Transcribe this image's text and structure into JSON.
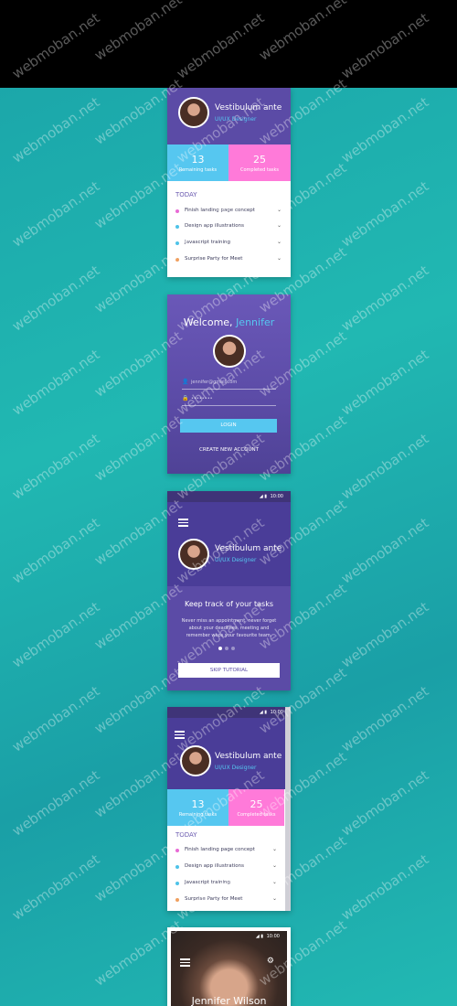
{
  "watermark": "webmoban.net",
  "colors": {
    "accent_blue": "#56c7f0",
    "accent_pink": "#ff7ad9",
    "purple": "#5b4ba6"
  },
  "screen1": {
    "name": "Vestibulum ante",
    "role": "UI/UX Designer",
    "stats": [
      {
        "value": "13",
        "label": "Remaining tasks"
      },
      {
        "value": "25",
        "label": "Completed tasks"
      }
    ],
    "section": "TODAY",
    "tasks": [
      {
        "label": "Finish landing page concept",
        "color": "#e86ad5"
      },
      {
        "label": "Design app illustrations",
        "color": "#4ec3e8"
      },
      {
        "label": "Javascript training",
        "color": "#4ec3e8"
      },
      {
        "label": "Surprise Party for Meet",
        "color": "#f0a060"
      }
    ]
  },
  "screen2": {
    "welcome": "Welcome,",
    "user": "Jennifer",
    "email_placeholder": "jennifer@gmail.com",
    "password_placeholder": "••••••••",
    "login": "LOGIN",
    "create": "CREATE NEW ACCOUNT"
  },
  "screen3": {
    "time": "10:00",
    "name": "Vestibulum ante",
    "role": "UI/UX Designer",
    "heading": "Keep track of your tasks",
    "body": "Never miss an appointment, never forget about your deadlines, meeting and remember whos your favourite team.",
    "skip": "SKIP TUTORIAL"
  },
  "screen4": {
    "time": "10:00",
    "name": "Vestibulum ante",
    "role": "UI/UX Designer",
    "stats": [
      {
        "value": "13",
        "label": "Remaining tasks"
      },
      {
        "value": "25",
        "label": "Completed tasks"
      }
    ],
    "section": "TODAY",
    "tasks": [
      {
        "label": "Finish landing page concept",
        "color": "#e86ad5"
      },
      {
        "label": "Design app illustrations",
        "color": "#4ec3e8"
      },
      {
        "label": "Javascript training",
        "color": "#4ec3e8"
      },
      {
        "label": "Surprise Party for Meet",
        "color": "#f0a060"
      }
    ]
  },
  "screen5": {
    "time": "10:00",
    "name": "Jennifer Wilson"
  }
}
